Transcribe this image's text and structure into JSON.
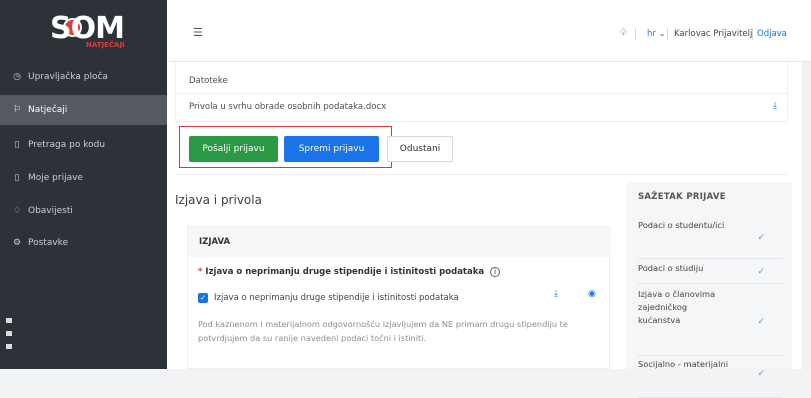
{
  "brand": {
    "logo_text": "SOM",
    "logo_sub": "NATJEČAJI"
  },
  "sidebar": {
    "items": [
      {
        "icon": "clock-icon",
        "label": "Upravljačka ploča"
      },
      {
        "icon": "flag-icon",
        "label": "Natječaji",
        "active": true
      },
      {
        "icon": "document-icon",
        "label": "Pretraga po kodu"
      },
      {
        "icon": "document-icon",
        "label": "Moje prijave"
      },
      {
        "icon": "bell-icon",
        "label": "Obavijesti"
      },
      {
        "icon": "gear-icon",
        "label": "Postavke"
      }
    ]
  },
  "topbar": {
    "language": "hr",
    "user": "Karlovac Prijavitelj",
    "logout": "Odjava"
  },
  "files": {
    "header": "Datoteke",
    "file_name": "Privola u svrhu obrade osobnih podataka.docx"
  },
  "actions": {
    "send": "Pošalji prijavu",
    "save": "Spremi prijavu",
    "cancel": "Odustani"
  },
  "section": {
    "title": "Izjava i privola",
    "card_header": "IZJAVA",
    "field_label": "Izjava o neprimanju druge stipendije i istinitosti podataka",
    "checkbox_label": "Izjava o neprimanju druge stipendije i istinitosti podataka",
    "description": "Pod kaznenom i materijalnom odgovornošću izjavljujem da NE primam drugu stipendiju te potvrdjujem da su ranije navedeni podaci točni i istiniti."
  },
  "summary": {
    "title": "SAŽETAK PRIJAVE",
    "items": [
      "Podaci o studentu/ici",
      "Podaci o studiju",
      "Izjava o članovima zajedničkog kućanstva",
      "Socijalno - materijalni"
    ]
  },
  "colors": {
    "accent": "#1a73e8",
    "success": "#2b9a46",
    "highlight": "#d33b3b",
    "sidebar": "#2d3238"
  }
}
